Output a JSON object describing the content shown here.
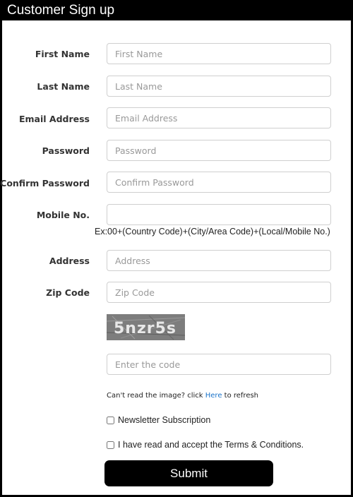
{
  "window": {
    "title": "Customer Sign up"
  },
  "form": {
    "fields": [
      {
        "label": "First Name",
        "placeholder": "First Name",
        "value": ""
      },
      {
        "label": "Last Name",
        "placeholder": "Last Name",
        "value": ""
      },
      {
        "label": "Email Address",
        "placeholder": "Email Address",
        "value": ""
      },
      {
        "label": "Password",
        "placeholder": "Password",
        "value": ""
      },
      {
        "label": "Confirm Password",
        "placeholder": "Confirm Password",
        "value": ""
      },
      {
        "label": "Mobile No.",
        "placeholder": "",
        "value": ""
      },
      {
        "label": "Address",
        "placeholder": "Address",
        "value": ""
      },
      {
        "label": "Zip Code",
        "placeholder": "Zip Code",
        "value": ""
      }
    ],
    "mobile_hint": "Ex:00+(Country Code)+(City/Area Code)+(Local/Mobile No.)",
    "captcha": {
      "image_text": "5nzr5s",
      "input_placeholder": "Enter the code",
      "refresh_prefix": "Can't read the image? click ",
      "refresh_link": "Here",
      "refresh_suffix": " to refresh"
    },
    "newsletter_label": "Newsletter Subscription",
    "newsletter_checked": false,
    "terms_label": "I have read and accept the Terms & Conditions.",
    "terms_checked": false,
    "submit_label": "Submit"
  },
  "colors": {
    "window_bg": "#000000",
    "panel_bg": "#ffffff",
    "link": "#1a73c9",
    "submit_bg": "#000000"
  }
}
